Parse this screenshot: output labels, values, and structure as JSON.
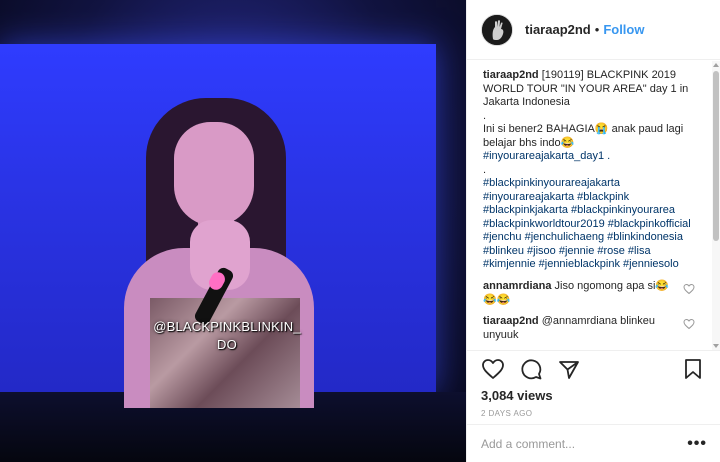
{
  "media": {
    "watermark_line1": "@BLACKPINKBLINKIN_",
    "watermark_line2": "DO"
  },
  "header": {
    "username": "tiaraap2nd",
    "separator": "•",
    "follow_label": "Follow"
  },
  "caption": {
    "username": "tiaraap2nd",
    "lines": [
      "[190119] BLACKPINK 2019",
      "WORLD TOUR \"IN YOUR AREA\" day 1 in",
      "Jakarta Indonesia",
      ".",
      "Ini si bener2 BAHAGIA😭 anak paud lagi",
      "belajar bhs indo😂",
      "#inyourareajakarta_day1 .",
      ".",
      "#blackpinkinyourareajakarta",
      "#inyourareajakarta #blackpink",
      "#blackpinkjakarta #blackpinkinyourarea",
      "#blackpinkworldtour2019 #blackpinkofficial",
      "#jenchu #jenchulichaeng #blinkindonesia",
      "#blinkeu #jisoo #jennie #rose #lisa",
      "#kimjennie #jennieblackpink #jenniesolo"
    ]
  },
  "comments": [
    {
      "username": "annamrdiana",
      "text": "Jiso ngomong apa si😂",
      "text2": "😂😂"
    },
    {
      "username": "tiaraap2nd",
      "text": "@annamrdiana blinkeu",
      "text2": "unyuuk"
    }
  ],
  "stats": {
    "views": "3,084 views",
    "timestamp": "2 DAYS AGO"
  },
  "add_comment": {
    "placeholder": "Add a comment...",
    "more": "•••"
  },
  "colors": {
    "follow_blue": "#3897f0",
    "hashtag": "#003569",
    "meta_gray": "#999999",
    "stage_blue": "#2f3cff"
  },
  "icons": [
    "heart-icon",
    "comment-icon",
    "share-icon",
    "bookmark-icon",
    "more-icon"
  ]
}
